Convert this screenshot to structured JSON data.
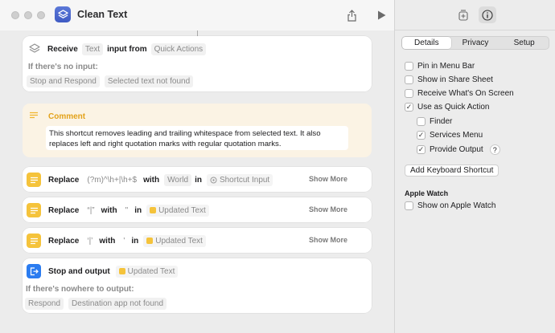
{
  "window": {
    "title": "Clean Text"
  },
  "receive": {
    "verb": "Receive",
    "type_token": "Text",
    "input_from_label": "input from",
    "source_token": "Quick Actions",
    "no_input_label": "If there's no input:",
    "action_token": "Stop and Respond",
    "message_token": "Selected text not found"
  },
  "comment": {
    "title": "Comment",
    "text": "This shortcut removes leading and trailing whitespace from selected text. It also replaces left and right quotation marks with regular quotation marks."
  },
  "replace_actions": [
    {
      "verb": "Replace",
      "find": "(?m)^\\h+|\\h+$",
      "with_label": "with",
      "replacement": "World",
      "in_label": "in",
      "target_var": "Shortcut Input",
      "show_more": "Show More"
    },
    {
      "verb": "Replace",
      "find": "“|”",
      "with_label": "with",
      "replacement": "\"",
      "in_label": "in",
      "target_var": "Updated Text",
      "show_more": "Show More"
    },
    {
      "verb": "Replace",
      "find": "‘|’",
      "with_label": "with",
      "replacement": "'",
      "in_label": "in",
      "target_var": "Updated Text",
      "show_more": "Show More"
    }
  ],
  "stop_output": {
    "verb": "Stop and output",
    "var": "Updated Text",
    "nowhere_label": "If there's nowhere to output:",
    "action_token": "Respond",
    "message_token": "Destination app not found"
  },
  "sidebar": {
    "tabs": [
      "Details",
      "Privacy",
      "Setup"
    ],
    "active_tab": "Details",
    "options": [
      {
        "label": "Pin in Menu Bar",
        "checked": false
      },
      {
        "label": "Show in Share Sheet",
        "checked": false
      },
      {
        "label": "Receive What's On Screen",
        "checked": false
      },
      {
        "label": "Use as Quick Action",
        "checked": true
      }
    ],
    "quick_action_options": [
      {
        "label": "Finder",
        "checked": false
      },
      {
        "label": "Services Menu",
        "checked": true
      },
      {
        "label": "Provide Output",
        "checked": true
      }
    ],
    "help_glyph": "?",
    "add_shortcut_button": "Add Keyboard Shortcut",
    "apple_watch_heading": "Apple Watch",
    "apple_watch_option": {
      "label": "Show on Apple Watch",
      "checked": false
    }
  },
  "icons": {
    "app": "shortcuts-layers-icon",
    "share": "share-icon",
    "run": "play-icon",
    "library": "add-action-icon",
    "info": "info-icon",
    "colors": {
      "accent_blue": "#2b7cf0",
      "action_yellow": "#f5c33b",
      "comment_bg": "#fbf3e4"
    }
  }
}
